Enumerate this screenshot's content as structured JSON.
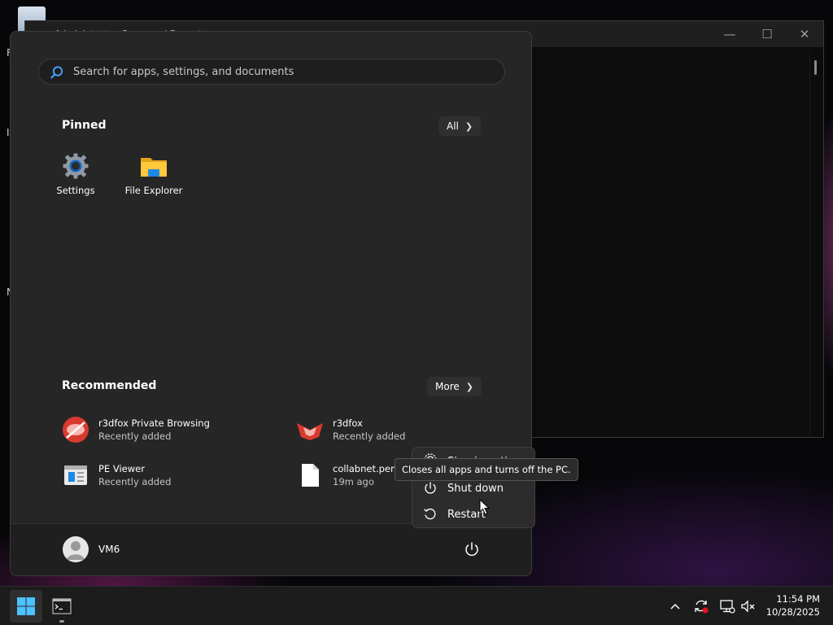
{
  "desktop": {
    "side_letters": [
      "F",
      "I",
      "N"
    ]
  },
  "terminal_window": {
    "title": "Administrator: Command Prompt",
    "controls": {
      "minimize": "—",
      "maximize": "☐",
      "close": "✕"
    }
  },
  "start_menu": {
    "search": {
      "placeholder": "Search for apps, settings, and documents",
      "value": ""
    },
    "pinned": {
      "title": "Pinned",
      "all_label": "All",
      "apps": [
        {
          "label": "Settings",
          "icon": "settings-gear-icon"
        },
        {
          "label": "File Explorer",
          "icon": "folder-icon"
        }
      ]
    },
    "recommended": {
      "title": "Recommended",
      "more_label": "More",
      "items": [
        {
          "name": "r3dfox Private Browsing",
          "sub": "Recently added",
          "icon": "r3dfox-private-icon"
        },
        {
          "name": "r3dfox",
          "sub": "Recently added",
          "icon": "r3dfox-icon"
        },
        {
          "name": "PE Viewer",
          "sub": "Recently added",
          "icon": "pe-viewer-icon"
        },
        {
          "name": "collabnet.pem",
          "sub": "19m ago",
          "icon": "file-icon"
        }
      ]
    },
    "user": {
      "name": "VM6"
    }
  },
  "power_menu": {
    "items": [
      {
        "label": "Sign-in options",
        "icon": "gear-icon"
      },
      {
        "label": "Shut down",
        "icon": "power-icon"
      },
      {
        "label": "Restart",
        "icon": "restart-icon"
      }
    ],
    "tooltip": "Closes all apps and turns off the PC."
  },
  "taskbar": {
    "clock": {
      "time": "11:54 PM",
      "date": "10/28/2025"
    }
  },
  "colors": {
    "accent": "#0078d4",
    "menu_bg": "#262626",
    "taskbar_bg": "#1c1c1c"
  }
}
